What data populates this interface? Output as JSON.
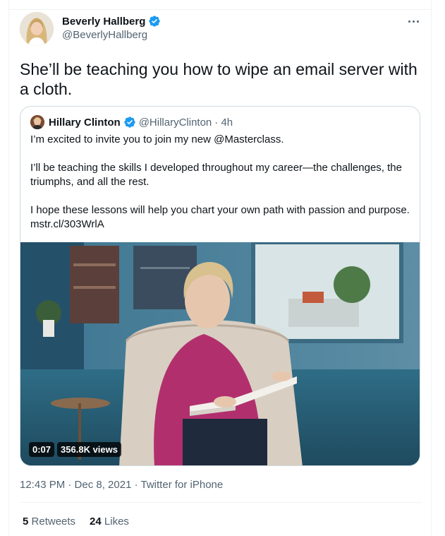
{
  "tweet": {
    "author_name": "Beverly Hallberg",
    "author_handle": "@BeverlyHallberg",
    "text": "She’ll be teaching you how to wipe an email server with a cloth.",
    "timestamp": "12:43 PM · Dec 8, 2021",
    "separator": "·",
    "client": "Twitter for iPhone",
    "retweets_count": "5",
    "retweets_label": "Retweets",
    "likes_count": "24",
    "likes_label": "Likes"
  },
  "quoted": {
    "author_name": "Hillary Clinton",
    "author_handle": "@HillaryClinton",
    "age": "· 4h",
    "line1": "I’m excited to invite you to join my new @Masterclass.",
    "line2": "I’ll be teaching the skills I developed throughout my career—the challenges, the triumphs, and all the rest.",
    "line3": "I hope these lessons will help you chart your own path with passion and purpose.",
    "link": "mstr.cl/303WrlA",
    "video_time": "0:07",
    "video_views": "356.8K views"
  },
  "colors": {
    "verified": "#1d9bf0",
    "muted": "#536471",
    "text": "#0f1419",
    "border": "#cfd9de"
  },
  "icons": [
    "verified-badge-icon",
    "more-options-icon"
  ]
}
